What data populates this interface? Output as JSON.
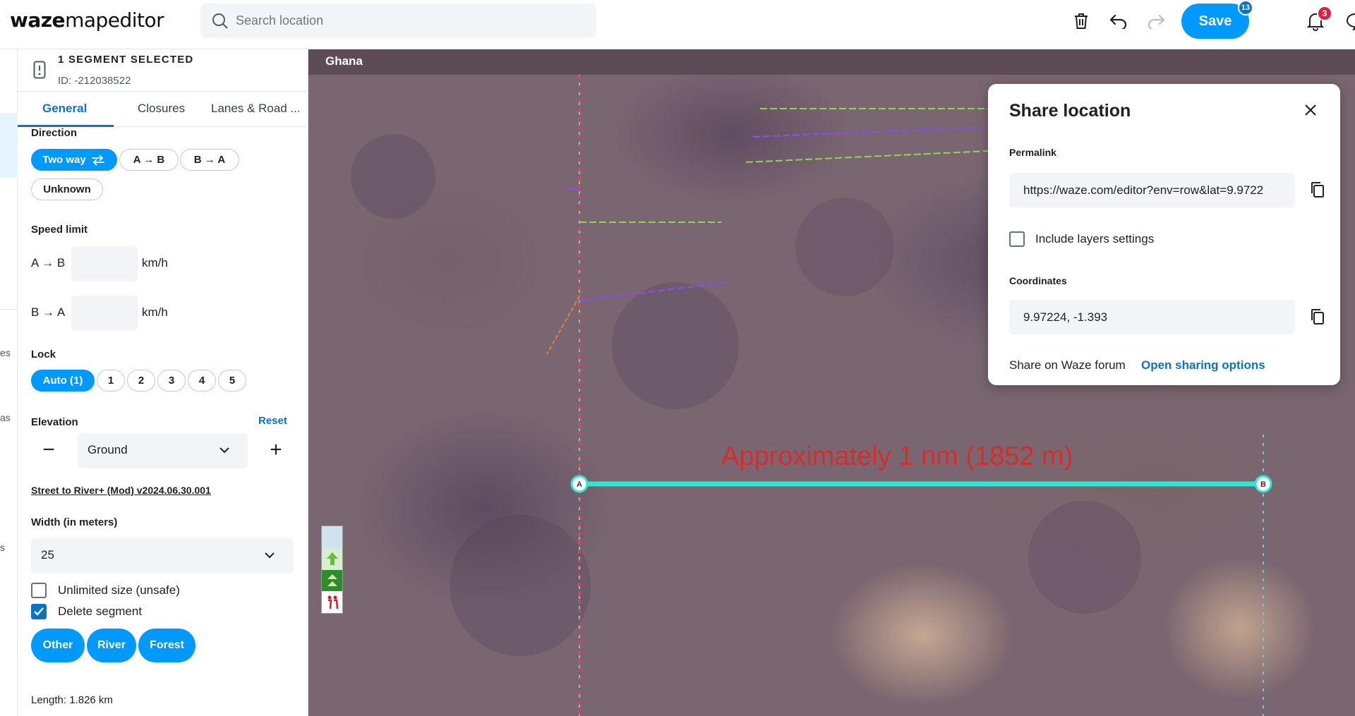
{
  "app": {
    "logo_bold": "waze",
    "logo_rest": "mapeditor"
  },
  "search": {
    "placeholder": "Search location"
  },
  "toolbar": {
    "save_label": "Save",
    "save_count": "13",
    "notification_count": "3"
  },
  "rail": {
    "item_1": "es",
    "item_2": "as",
    "item_3": "s"
  },
  "segment": {
    "title": "1 SEGMENT SELECTED",
    "id": "ID: -212038522"
  },
  "tabs": [
    {
      "label": "General"
    },
    {
      "label": "Closures"
    },
    {
      "label": "Lanes & Road ..."
    }
  ],
  "direction": {
    "label": "Direction",
    "options": [
      {
        "label": "Two way"
      },
      {
        "label": "A → B"
      },
      {
        "label": "B → A"
      },
      {
        "label": "Unknown"
      }
    ],
    "selected": "Two way"
  },
  "speed_limit": {
    "label": "Speed limit",
    "rows": [
      {
        "label": "A → B",
        "value": "",
        "unit": "km/h"
      },
      {
        "label": "B → A",
        "value": "",
        "unit": "km/h"
      }
    ]
  },
  "lock": {
    "label": "Lock",
    "options": [
      "Auto (1)",
      "1",
      "2",
      "3",
      "4",
      "5"
    ],
    "selected": "Auto (1)"
  },
  "elevation": {
    "label": "Elevation",
    "reset": "Reset",
    "value": "Ground",
    "minus": "−",
    "plus": "+"
  },
  "script_link": "Street to River+ (Mod) v2024.06.30.001",
  "width": {
    "label": "Width (in meters)",
    "value": "25"
  },
  "options": [
    {
      "label": "Unlimited size (unsafe)",
      "checked": false
    },
    {
      "label": "Delete segment",
      "checked": true
    }
  ],
  "type_buttons": [
    "Other",
    "River",
    "Forest"
  ],
  "length": "Length: 1.826 km",
  "map": {
    "country": "Ghana",
    "measure_text": "Approximately 1 nm (1852 m)",
    "node_a": "A",
    "node_b": "B",
    "measure_color": "#2ee6d6"
  },
  "share": {
    "title": "Share location",
    "permalink_label": "Permalink",
    "permalink": "https://waze.com/editor?env=row&lat=9.9722",
    "include_layers": "Include layers settings",
    "coordinates_label": "Coordinates",
    "coordinates": "9.97224, -1.393",
    "forum_text": "Share on Waze forum",
    "open_link": "Open sharing options"
  },
  "colors": {
    "accent": "#0099ff",
    "link": "#0b72c7",
    "badge_red": "#e0203a"
  }
}
